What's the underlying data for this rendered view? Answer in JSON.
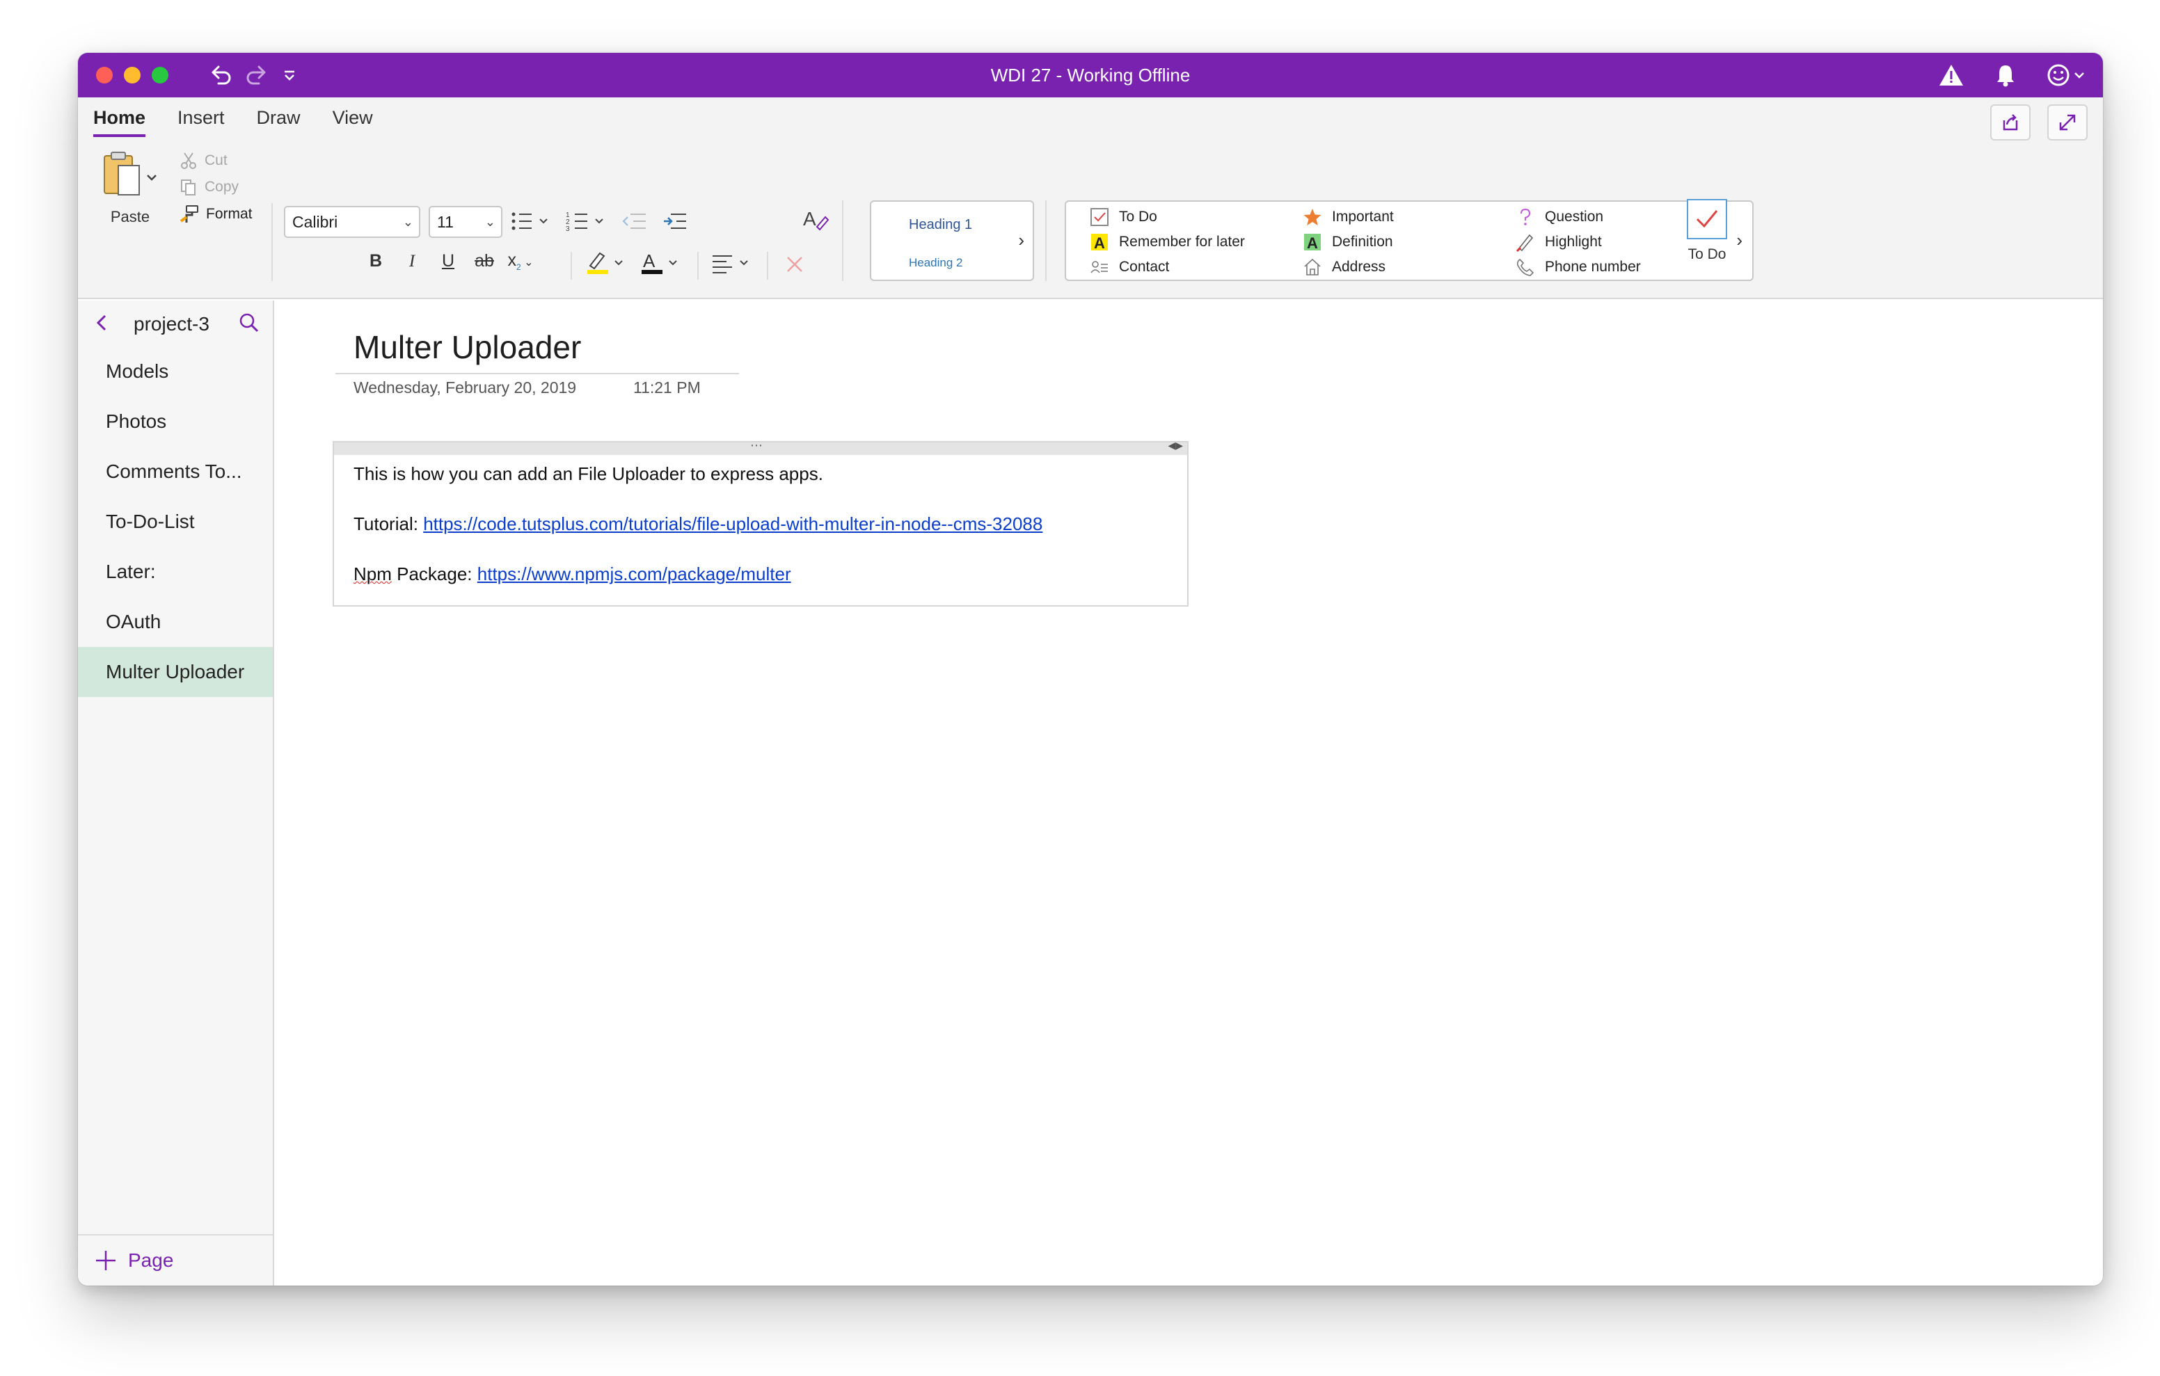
{
  "window": {
    "title": "WDI 27 - Working Offline"
  },
  "ribbon": {
    "tabs": [
      {
        "label": "Home",
        "active": true
      },
      {
        "label": "Insert",
        "active": false
      },
      {
        "label": "Draw",
        "active": false
      },
      {
        "label": "View",
        "active": false
      }
    ],
    "clipboard": {
      "paste": "Paste",
      "cut": "Cut",
      "copy": "Copy",
      "format": "Format"
    },
    "font": {
      "family": "Calibri",
      "size": "11"
    },
    "styles": {
      "heading1": "Heading 1",
      "heading2": "Heading 2"
    },
    "tags": {
      "todo": "To Do",
      "remember": "Remember for later",
      "contact": "Contact",
      "important": "Important",
      "definition": "Definition",
      "address": "Address",
      "question": "Question",
      "highlight": "Highlight",
      "phone": "Phone number"
    },
    "todo_button": "To Do"
  },
  "sidebar": {
    "section": "project-3",
    "pages": [
      {
        "label": "Models"
      },
      {
        "label": "Photos"
      },
      {
        "label": "Comments To..."
      },
      {
        "label": "To-Do-List"
      },
      {
        "label": "Later:"
      },
      {
        "label": "OAuth"
      },
      {
        "label": "Multer Uploader"
      }
    ],
    "add_page": "Page"
  },
  "note": {
    "title": "Multer Uploader",
    "date": "Wednesday, February 20, 2019",
    "time": "11:21 PM",
    "line1": "This is how you can add an File Uploader to express apps.",
    "tutorial_label": "Tutorial: ",
    "tutorial_url": "https://code.tutsplus.com/tutorials/file-upload-with-multer-in-node--cms-32088",
    "npm_word": "Npm",
    "package_label": " Package: ",
    "package_url": "https://www.npmjs.com/package/multer"
  },
  "colors": {
    "titlebar": "#7a22b0",
    "active_page": "#d3e8dc",
    "link": "#0b3dcc"
  }
}
